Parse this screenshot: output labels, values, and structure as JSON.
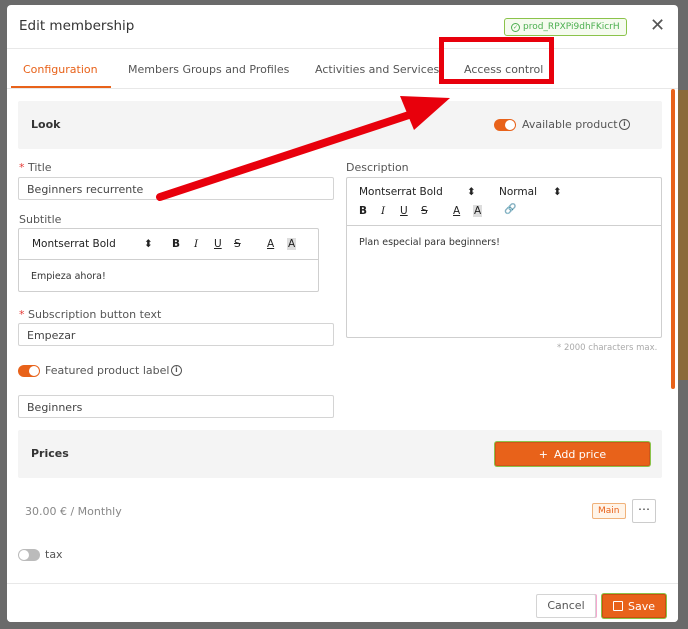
{
  "modal": {
    "title": "Edit membership",
    "product_id": "prod_RPXPi9dhFKicrH",
    "close_glyph": "✕"
  },
  "tabs": [
    {
      "label": "Configuration",
      "active": true
    },
    {
      "label": "Members Groups and Profiles",
      "active": false
    },
    {
      "label": "Activities and Services",
      "active": false
    },
    {
      "label": "Access control",
      "active": false
    }
  ],
  "look": {
    "section_title": "Look",
    "available_label": "Available product",
    "available_on": true
  },
  "form": {
    "title_label": "Title",
    "title_value": "Beginners recurrente",
    "subtitle_label": "Subtitle",
    "subtitle_editor": {
      "font": "Montserrat Bold",
      "content": "Empieza ahora!"
    },
    "description_label": "Description",
    "description_editor": {
      "font": "Montserrat Bold",
      "size": "Normal",
      "content": "Plan especial para beginners!"
    },
    "char_count": "* 2000 characters max.",
    "subscription_label": "Subscription button text",
    "subscription_value": "Empezar",
    "featured_label": "Featured product label",
    "featured_on": true,
    "featured_value": "Beginners",
    "required_mark": "*"
  },
  "toolbar_glyphs": {
    "bold": "B",
    "italic": "I",
    "underline": "U",
    "strike": "S",
    "color": "A",
    "highlight": "A",
    "link": "🔗",
    "select_arrow": "⬍"
  },
  "prices": {
    "section_title": "Prices",
    "add_label": "Add price",
    "add_glyph": "+",
    "row_text": "30.00 € / Monthly",
    "row_badge": "Main",
    "more_glyph": "⋯"
  },
  "tax": {
    "label": "tax",
    "on": false
  },
  "footer": {
    "cancel_label": "Cancel",
    "save_label": "Save"
  },
  "colors": {
    "accent": "#e8621a",
    "annotation_red": "#e8000c",
    "badge_green": "#4caf50"
  },
  "icons": [
    "close-icon",
    "check-circle-icon",
    "info-icon",
    "link-icon",
    "plus-icon",
    "save-icon",
    "more-icon"
  ]
}
